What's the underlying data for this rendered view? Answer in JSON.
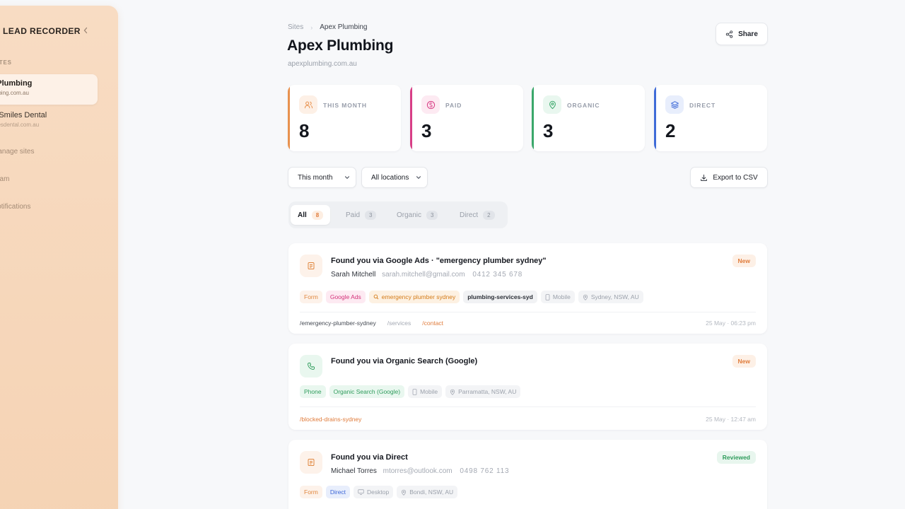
{
  "sidebar": {
    "brand": "LEAD RECORDER",
    "section_label": "R SITES",
    "sites": [
      {
        "name": "ex Plumbing",
        "url": "plumbing.com.au"
      },
      {
        "name": "ght Smiles Dental",
        "url": "tsmilesdental.com.au"
      }
    ],
    "nav": [
      "Manage sites",
      "Team",
      "Notifications"
    ]
  },
  "breadcrumb": {
    "root": "Sites",
    "sep": "›",
    "current": "Apex Plumbing"
  },
  "page": {
    "title": "Apex Plumbing",
    "url": "apexplumbing.com.au",
    "share_label": "Share"
  },
  "stats": [
    {
      "label": "THIS MONTH",
      "value": "8",
      "color": "#e8924f",
      "icon": "users-icon"
    },
    {
      "label": "PAID",
      "value": "3",
      "color": "#d83e86",
      "icon": "dollar-icon"
    },
    {
      "label": "ORGANIC",
      "value": "3",
      "color": "#3aa76a",
      "icon": "map-pin-icon"
    },
    {
      "label": "DIRECT",
      "value": "2",
      "color": "#3f6bd8",
      "icon": "layers-icon"
    }
  ],
  "filters": {
    "period": "This month",
    "location": "All locations",
    "export_label": "Export to CSV"
  },
  "tabs": [
    {
      "label": "All",
      "count": "8"
    },
    {
      "label": "Paid",
      "count": "3"
    },
    {
      "label": "Organic",
      "count": "3"
    },
    {
      "label": "Direct",
      "count": "2"
    }
  ],
  "leads": [
    {
      "title": "Found you via Google Ads · \"emergency plumber sydney\"",
      "name": "Sarah Mitchell",
      "email": "sarah.mitchell@gmail.com",
      "phone": "0412 345 678",
      "status": "New",
      "chips": {
        "type": "Form",
        "source": "Google Ads",
        "keyword": "emergency plumber sydney",
        "campaign": "plumbing-services-syd",
        "device": "Mobile",
        "location": "Sydney, NSW, AU"
      },
      "paths": [
        "/emergency-plumber-sydney",
        "/services",
        "/contact"
      ],
      "time": "25 May · 06:23 pm"
    },
    {
      "title": "Found you via Organic Search (Google)",
      "status": "New",
      "chips": {
        "type": "Phone",
        "source": "Organic Search (Google)",
        "device": "Mobile",
        "location": "Parramatta, NSW, AU"
      },
      "paths": [
        "/blocked-drains-sydney"
      ],
      "time": "25 May · 12:47 am"
    },
    {
      "title": "Found you via Direct",
      "name": "Michael Torres",
      "email": "mtorres@outlook.com",
      "phone": "0498 762 113",
      "status": "Reviewed",
      "chips": {
        "type": "Form",
        "source": "Direct",
        "device": "Desktop",
        "location": "Bondi, NSW, AU"
      }
    }
  ]
}
